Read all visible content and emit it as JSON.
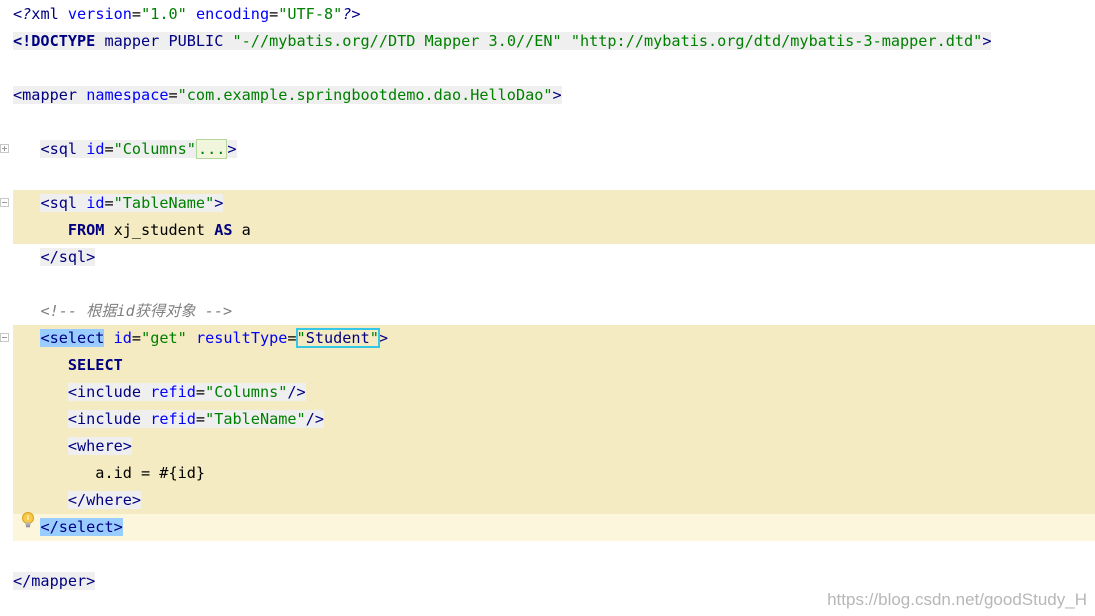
{
  "lines": {
    "xml_decl": {
      "open": "<?",
      "name": "xml",
      "attr1": "version",
      "eq1": "=",
      "val1": "\"1.0\"",
      "attr2": "encoding",
      "eq2": "=",
      "val2": "\"UTF-8\"",
      "close": "?>"
    },
    "doctype": {
      "open": "<!DOCTYPE",
      "root": "mapper",
      "kind": "PUBLIC",
      "public_id": "\"-//mybatis.org//DTD Mapper 3.0//EN\"",
      "system_id": "\"http://mybatis.org/dtd/mybatis-3-mapper.dtd\"",
      "close": ">"
    },
    "mapper_open": {
      "lt": "<",
      "name": "mapper",
      "attr": "namespace",
      "eq": "=",
      "val": "\"com.example.springbootdemo.dao.HelloDao\"",
      "gt": ">"
    },
    "sql_columns": {
      "lt": "<",
      "name": "sql",
      "attr": "id",
      "eq": "=",
      "val": "\"Columns\"",
      "folded": "...",
      "gt": ">"
    },
    "sql_tablename_open": {
      "lt": "<",
      "name": "sql",
      "attr": "id",
      "eq": "=",
      "val": "\"TableName\"",
      "gt": ">"
    },
    "from_line": {
      "kw1": "FROM",
      "table": " xj_student ",
      "kw2": "AS",
      "alias": " a"
    },
    "sql_close": {
      "text": "</sql>"
    },
    "comment": {
      "text": "<!-- 根据id获得对象 -->"
    },
    "select_open": {
      "lt": "<",
      "name": "select",
      "attr1": "id",
      "eq1": "=",
      "val1": "\"get\"",
      "attr2": "resultType",
      "eq2": "=",
      "val2_open": "\"",
      "val2_text": "Student",
      "val2_close": "\"",
      "gt": ">"
    },
    "select_kw": {
      "text": "SELECT"
    },
    "include1": {
      "lt": "<",
      "name": "include",
      "attr": "refid",
      "eq": "=",
      "val": "\"Columns\"",
      "gt": "/>"
    },
    "include2": {
      "lt": "<",
      "name": "include",
      "attr": "refid",
      "eq": "=",
      "val": "\"TableName\"",
      "gt": "/>"
    },
    "where_open": {
      "lt": "<",
      "name": "where",
      "gt": ">"
    },
    "where_cond": {
      "text": "a.id = #{id}"
    },
    "where_close": {
      "text": "</where>"
    },
    "select_close": {
      "lt": "</",
      "name": "select",
      "gt": ">"
    },
    "mapper_close": {
      "text": "</mapper>"
    }
  },
  "icons": {
    "bulb": "lightbulb-icon",
    "fold_expand": "fold-expand-icon",
    "fold_collapse": "fold-collapse-icon"
  },
  "colors": {
    "tag": "#000080",
    "attribute": "#0000ff",
    "string": "#008000",
    "comment": "#808080",
    "highlight": "#f5ebc2",
    "selection_box": "#36c6e6"
  },
  "watermark": "https://blog.csdn.net/goodStudy_H"
}
